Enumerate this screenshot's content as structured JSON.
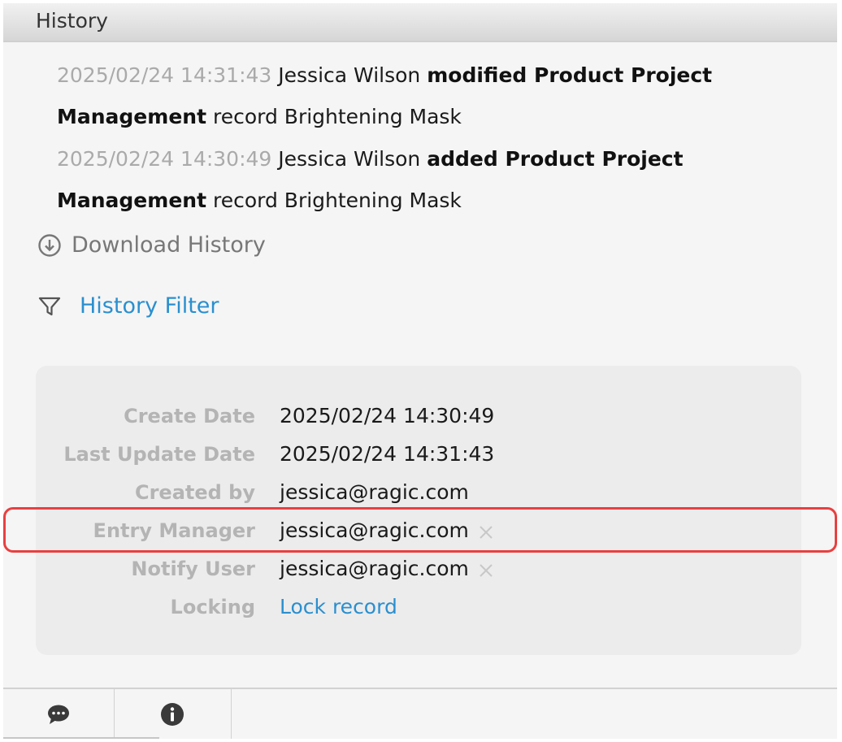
{
  "header": {
    "title": "History"
  },
  "history": [
    {
      "timestamp": "2025/02/24 14:31:43",
      "user": "Jessica Wilson",
      "action": "modified Product Project",
      "action_cont": "Management",
      "record_text": "record Brightening Mask"
    },
    {
      "timestamp": "2025/02/24 14:30:49",
      "user": "Jessica Wilson",
      "action": "added Product Project",
      "action_cont": "Management",
      "record_text": "record Brightening Mask"
    }
  ],
  "actions": {
    "download_label": "Download History",
    "download_icon": "download-circle-icon",
    "filter_label": "History Filter",
    "filter_icon": "funnel-icon"
  },
  "info": {
    "create_date": {
      "label": "Create Date",
      "value": "2025/02/24 14:30:49"
    },
    "last_update_date": {
      "label": "Last Update Date",
      "value": "2025/02/24 14:31:43"
    },
    "created_by": {
      "label": "Created by",
      "value": "jessica@ragic.com"
    },
    "entry_manager": {
      "label": "Entry Manager",
      "value": "jessica@ragic.com"
    },
    "notify_user": {
      "label": "Notify User",
      "value": "jessica@ragic.com"
    },
    "locking": {
      "label": "Locking",
      "value": "Lock record"
    }
  },
  "footer": {
    "tabs": [
      {
        "icon": "comment-icon"
      },
      {
        "icon": "info-icon"
      }
    ]
  },
  "colors": {
    "link": "#2a8fcf",
    "highlight": "#e84040"
  }
}
